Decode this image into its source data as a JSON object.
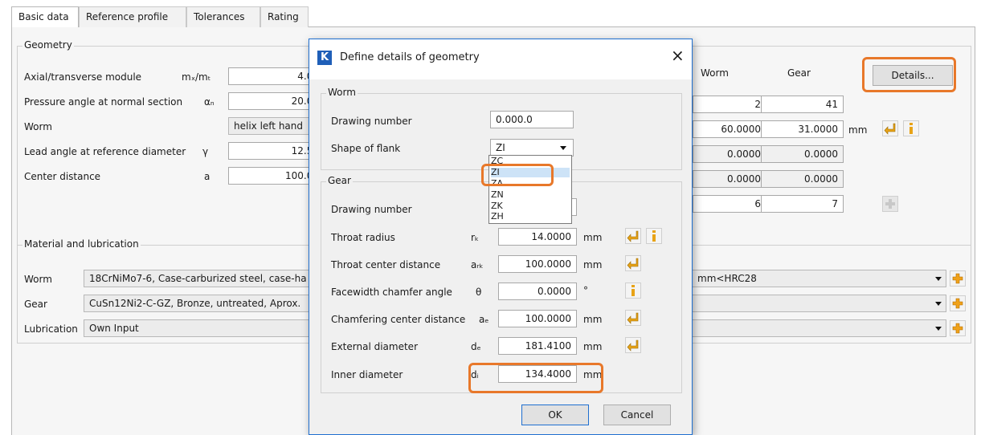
{
  "tabs": [
    "Basic data",
    "Reference profile",
    "Tolerances",
    "Rating"
  ],
  "geometry": {
    "title": "Geometry",
    "rows": [
      {
        "label": "Axial/transverse module",
        "symbol": "mₓ/mₜ",
        "value": "4.00"
      },
      {
        "label": "Pressure angle at normal section",
        "symbol": "αₙ",
        "value": "20.00"
      },
      {
        "label": "Worm",
        "symbol": "",
        "value": "helix left hand"
      },
      {
        "label": "Lead angle at reference diameter",
        "symbol": "γ",
        "value": "12.52"
      },
      {
        "label": "Center distance",
        "symbol": "a",
        "value": "100.00"
      }
    ],
    "col_worm": "Worm",
    "col_gear": "Gear",
    "details_label": "Details...",
    "teeth": {
      "worm": "2",
      "gear": "41"
    },
    "facewidth": {
      "worm": "60.0000",
      "gear": "31.0000",
      "unit": "mm"
    },
    "shift1": {
      "worm": "0.0000",
      "gear": "0.0000"
    },
    "shift2": {
      "worm": "0.0000",
      "gear": "0.0000"
    },
    "quality": {
      "worm": "6",
      "gear": "7"
    }
  },
  "material": {
    "title": "Material and lubrication",
    "worm": {
      "label": "Worm",
      "left": "18CrNiMo7-6, Case-carburized steel, case-ha",
      "right": "mm<HRC28"
    },
    "gear": {
      "label": "Gear",
      "left": "CuSn12Ni2-C-GZ, Bronze, untreated, Aprox."
    },
    "lubrication": {
      "label": "Lubrication",
      "left": "Own Input"
    }
  },
  "dialog": {
    "title": "Define details of geometry",
    "app_logo": "K",
    "close": "×",
    "worm_group": "Worm",
    "worm_drawing_label": "Drawing number",
    "worm_drawing_value": "0.000.0",
    "shape_label": "Shape of flank",
    "shape_value": "ZI",
    "shape_options": [
      "ZC",
      "ZI",
      "ZA",
      "ZN",
      "ZK",
      "ZH"
    ],
    "gear_group": "Gear",
    "gear_drawing_label": "Drawing number",
    "rows": [
      {
        "label": "Throat radius",
        "symbol": "rₖ",
        "value": "14.0000",
        "unit": "mm"
      },
      {
        "label": "Throat center distance",
        "symbol": "aᵣₖ",
        "value": "100.0000",
        "unit": "mm"
      },
      {
        "label": "Facewidth chamfer angle",
        "symbol": "θ",
        "value": "0.0000",
        "unit": "°"
      },
      {
        "label": "Chamfering center distance",
        "symbol": "aₑ",
        "value": "100.0000",
        "unit": "mm"
      },
      {
        "label": "External diameter",
        "symbol": "dₑ",
        "value": "181.4100",
        "unit": "mm"
      },
      {
        "label": "Inner diameter",
        "symbol": "dᵢ",
        "value": "134.4000",
        "unit": "mm"
      }
    ],
    "ok": "OK",
    "cancel": "Cancel"
  },
  "colors": {
    "highlight": "#e8782a",
    "arrow_icon": "#e8a317",
    "info_icon": "#e8a317",
    "add_icon": "#f0a21a",
    "accent_border": "#1f6fd0"
  }
}
